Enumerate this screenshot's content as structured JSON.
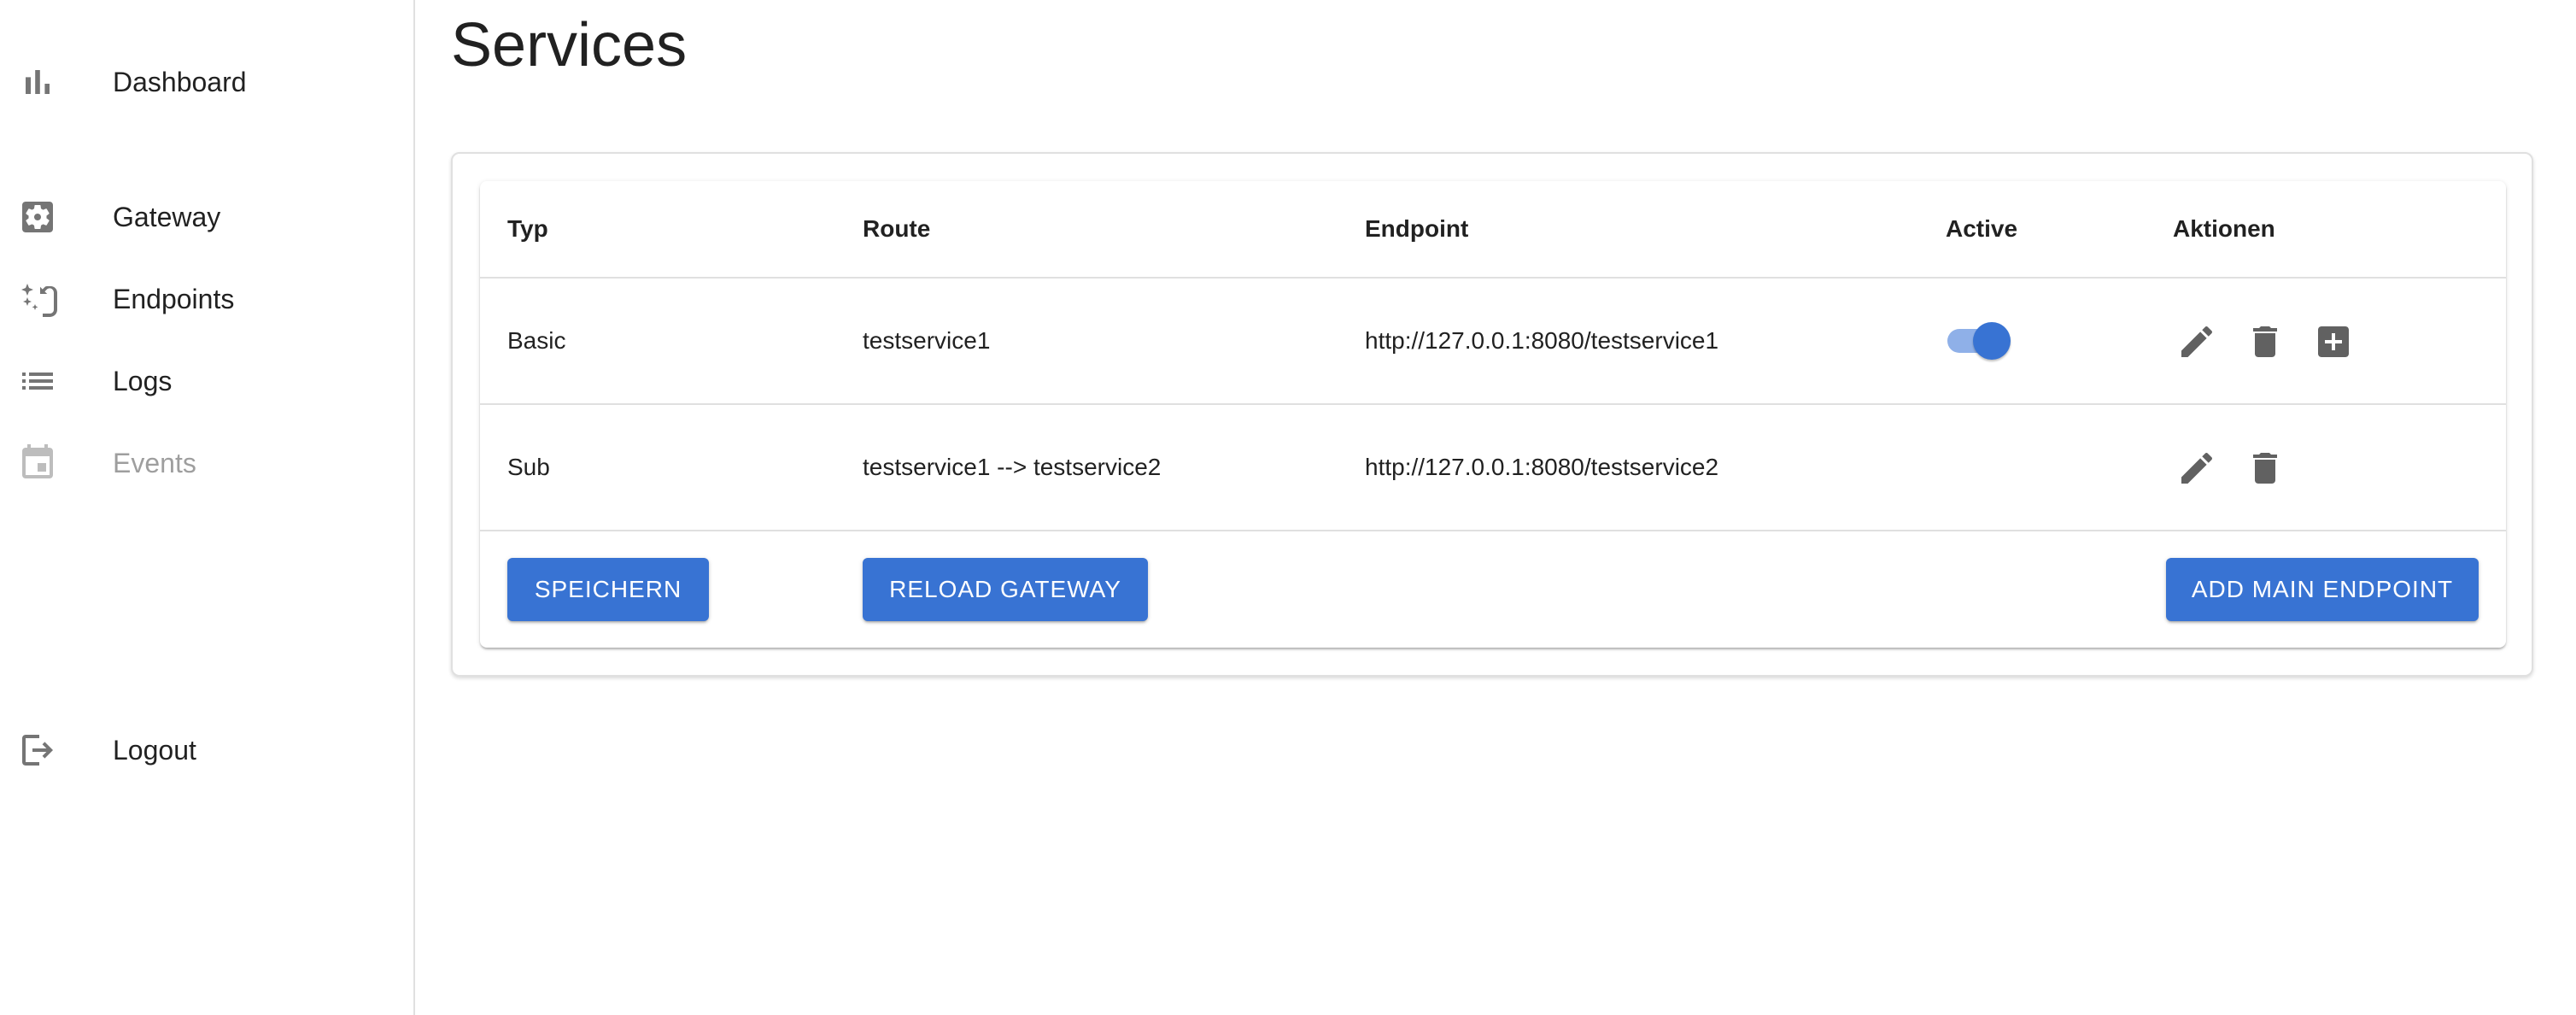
{
  "sidebar": {
    "items": [
      {
        "label": "Dashboard",
        "icon": "bar-chart-icon"
      },
      {
        "label": "Gateway",
        "icon": "settings-applications-icon"
      },
      {
        "label": "Endpoints",
        "icon": "call-split-icon"
      },
      {
        "label": "Logs",
        "icon": "list-icon"
      },
      {
        "label": "Events",
        "icon": "event-icon",
        "disabled": true
      },
      {
        "label": "Logout",
        "icon": "logout-icon"
      }
    ]
  },
  "main": {
    "title": "Services",
    "table": {
      "headers": {
        "typ": "Typ",
        "route": "Route",
        "endpoint": "Endpoint",
        "active": "Active",
        "actions": "Aktionen"
      },
      "rows": [
        {
          "typ": "Basic",
          "route": "testservice1",
          "endpoint": "http://127.0.0.1:8080/testservice1",
          "active": true
        },
        {
          "typ": "Sub",
          "route": "testservice1 --> testservice2",
          "endpoint": "http://127.0.0.1:8080/testservice2"
        }
      ]
    },
    "buttons": {
      "save": "SPEICHERN",
      "reload": "RELOAD GATEWAY",
      "add_main": "ADD MAIN ENDPOINT"
    }
  },
  "colors": {
    "primary": "#3873d3",
    "icon": "#757575",
    "disabled": "#bdbdbd"
  }
}
